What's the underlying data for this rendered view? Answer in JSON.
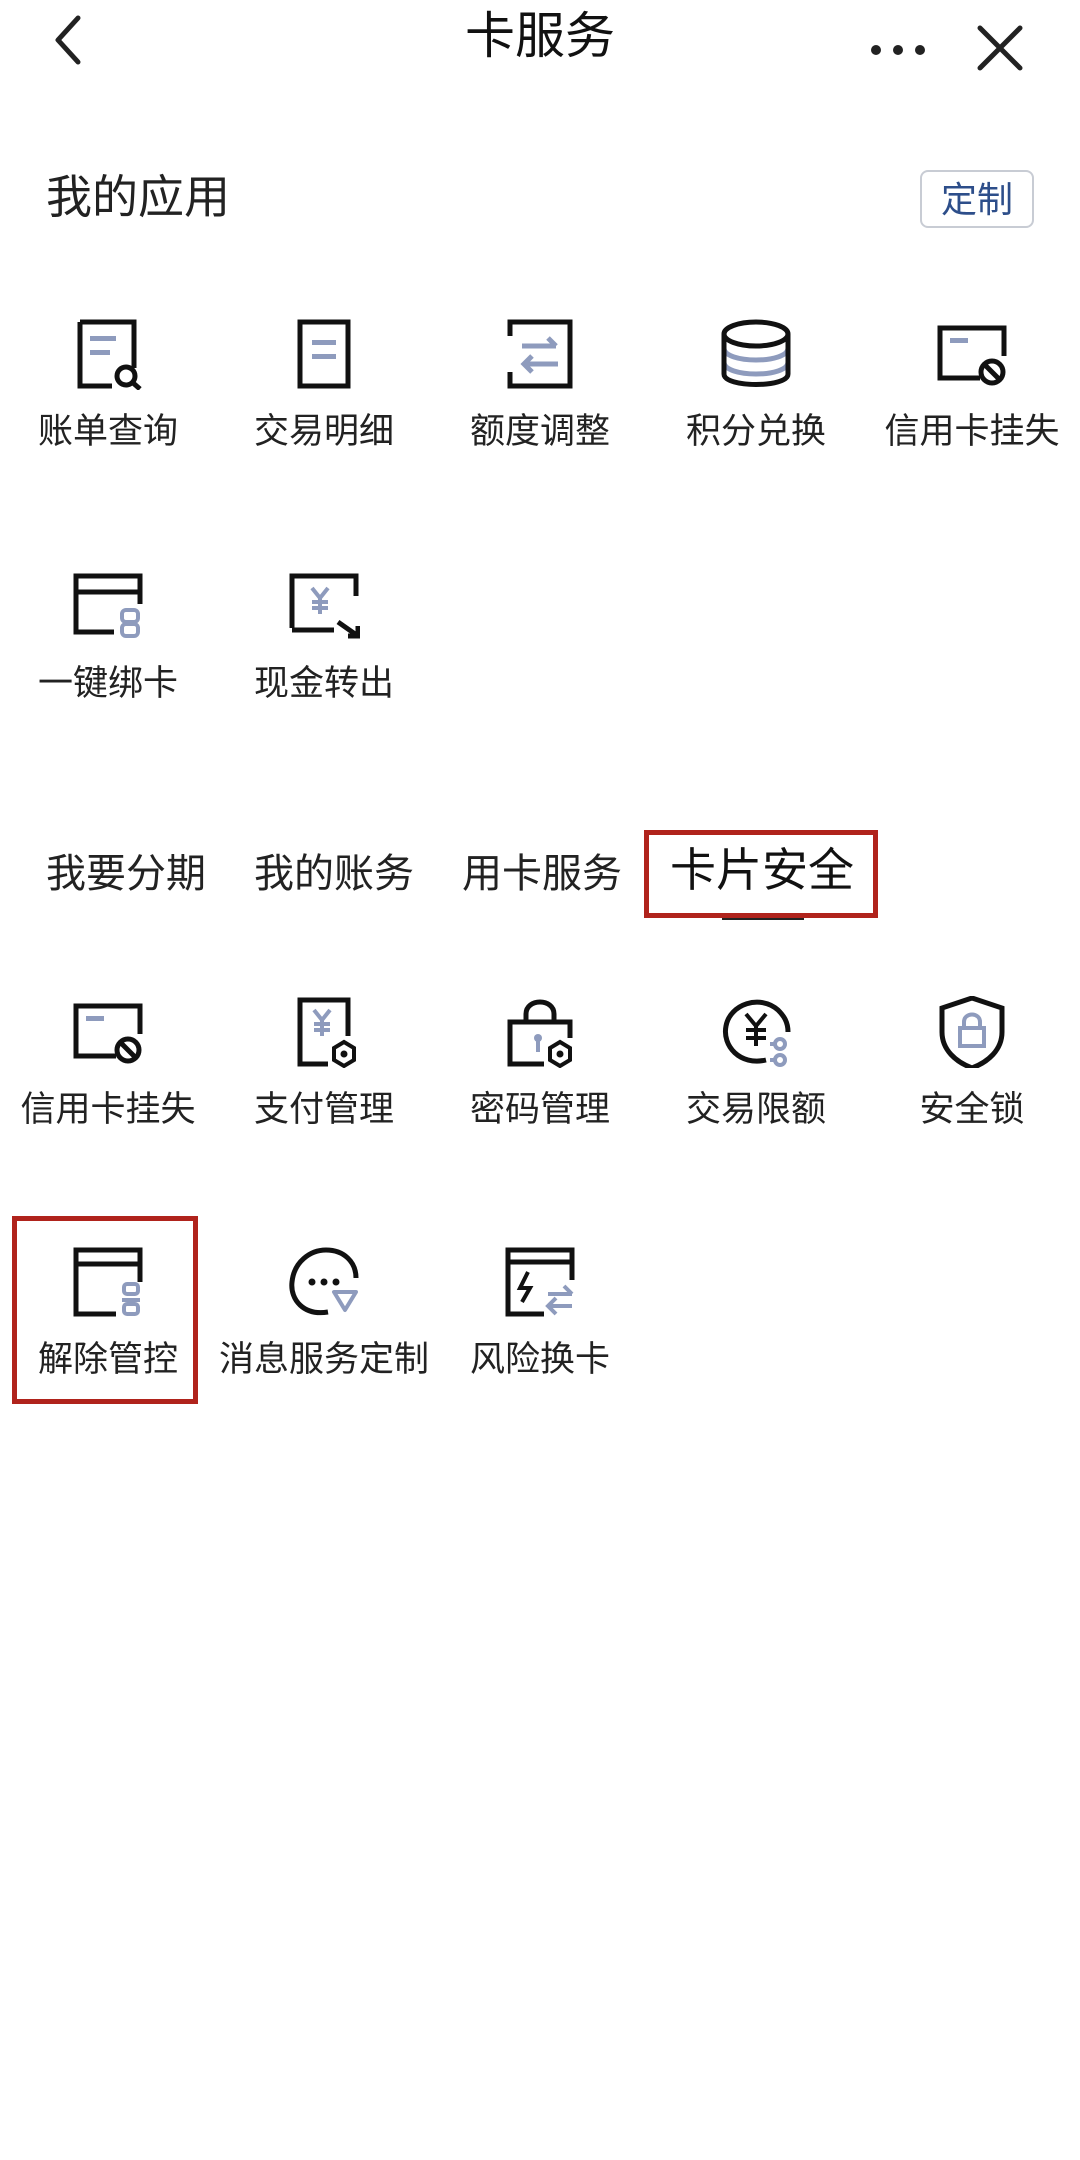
{
  "header": {
    "title": "卡服务"
  },
  "my_apps": {
    "title": "我的应用",
    "customize_label": "定制",
    "items": [
      {
        "label": "账单查询",
        "icon": "bill-search-icon"
      },
      {
        "label": "交易明细",
        "icon": "document-icon"
      },
      {
        "label": "额度调整",
        "icon": "adjust-limit-icon"
      },
      {
        "label": "积分兑换",
        "icon": "points-coins-icon"
      },
      {
        "label": "信用卡挂失",
        "icon": "card-block-icon"
      },
      {
        "label": "一键绑卡",
        "icon": "bind-card-icon"
      },
      {
        "label": "现金转出",
        "icon": "cash-out-icon"
      }
    ]
  },
  "tabs": [
    {
      "label": "我要分期",
      "active": false
    },
    {
      "label": "我的账务",
      "active": false
    },
    {
      "label": "用卡服务",
      "active": false
    },
    {
      "label": "卡片安全",
      "active": true
    }
  ],
  "security": {
    "items": [
      {
        "label": "信用卡挂失",
        "icon": "card-block-icon"
      },
      {
        "label": "支付管理",
        "icon": "payment-settings-icon"
      },
      {
        "label": "密码管理",
        "icon": "password-lock-icon"
      },
      {
        "label": "交易限额",
        "icon": "transaction-limit-icon"
      },
      {
        "label": "安全锁",
        "icon": "shield-lock-icon"
      },
      {
        "label": "解除管控",
        "icon": "release-control-icon"
      },
      {
        "label": "消息服务定制",
        "icon": "message-service-icon"
      },
      {
        "label": "风险换卡",
        "icon": "risk-card-swap-icon"
      }
    ]
  },
  "colors": {
    "accent": "#2d4e8a",
    "icon_secondary": "#8e9bbd",
    "highlight": "#b0231c"
  }
}
